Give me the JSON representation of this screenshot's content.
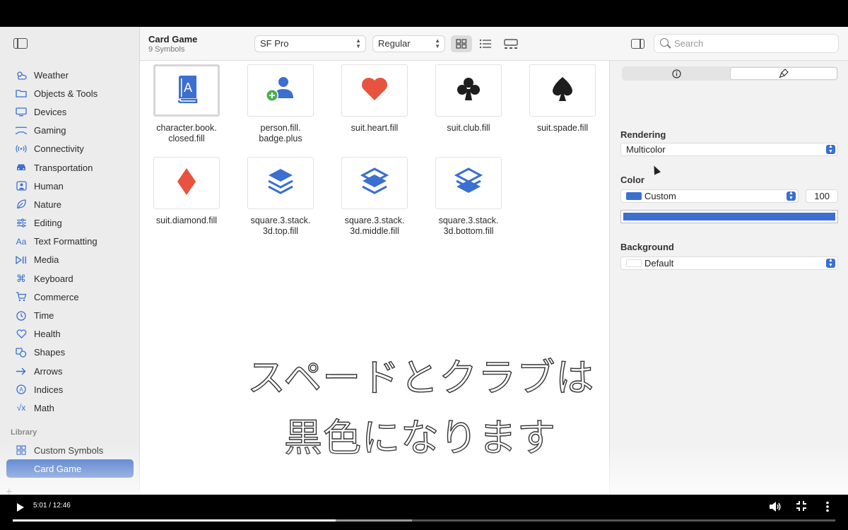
{
  "window": {
    "title": "Card Game",
    "subtitle": "9 Symbols"
  },
  "toolbar": {
    "font": "SF Pro",
    "weight": "Regular",
    "search_placeholder": "Search"
  },
  "sidebar": {
    "items": [
      {
        "label": "Weather",
        "icon": "cloud-sun-icon"
      },
      {
        "label": "Objects & Tools",
        "icon": "folder-icon"
      },
      {
        "label": "Devices",
        "icon": "monitor-icon"
      },
      {
        "label": "Gaming",
        "icon": "gamecontroller-icon"
      },
      {
        "label": "Connectivity",
        "icon": "antenna-icon"
      },
      {
        "label": "Transportation",
        "icon": "car-icon"
      },
      {
        "label": "Human",
        "icon": "person-icon"
      },
      {
        "label": "Nature",
        "icon": "leaf-icon"
      },
      {
        "label": "Editing",
        "icon": "sliders-icon"
      },
      {
        "label": "Text Formatting",
        "icon": "text-format-icon"
      },
      {
        "label": "Media",
        "icon": "play-pause-icon"
      },
      {
        "label": "Keyboard",
        "icon": "command-icon"
      },
      {
        "label": "Commerce",
        "icon": "cart-icon"
      },
      {
        "label": "Time",
        "icon": "clock-icon"
      },
      {
        "label": "Health",
        "icon": "heart-outline-icon"
      },
      {
        "label": "Shapes",
        "icon": "shapes-icon"
      },
      {
        "label": "Arrows",
        "icon": "arrows-icon"
      },
      {
        "label": "Indices",
        "icon": "circle-a-icon"
      },
      {
        "label": "Math",
        "icon": "sqrt-icon"
      }
    ],
    "library_header": "Library",
    "library": [
      {
        "label": "Custom Symbols",
        "icon": "grid-icon"
      },
      {
        "label": "Card Game",
        "icon": "folder-icon"
      }
    ]
  },
  "symbols": [
    {
      "name": "character.book.\nclosed.fill",
      "icon": "character-book-icon"
    },
    {
      "name": "person.fill.\nbadge.plus",
      "icon": "person-badge-plus-icon"
    },
    {
      "name": "suit.heart.fill",
      "icon": "heart-icon"
    },
    {
      "name": "suit.club.fill",
      "icon": "club-icon"
    },
    {
      "name": "suit.spade.fill",
      "icon": "spade-icon"
    },
    {
      "name": "suit.diamond.fill",
      "icon": "diamond-icon"
    },
    {
      "name": "square.3.stack.\n3d.top.fill",
      "icon": "stack-top-icon"
    },
    {
      "name": "square.3.stack.\n3d.middle.fill",
      "icon": "stack-middle-icon"
    },
    {
      "name": "square.3.stack.\n3d.bottom.fill",
      "icon": "stack-bottom-icon"
    }
  ],
  "inspector": {
    "rendering_label": "Rendering",
    "rendering_value": "Multicolor",
    "color_label": "Color",
    "color_value": "Custom",
    "opacity_value": "100",
    "background_label": "Background",
    "background_value": "Default"
  },
  "subtitles": [
    "スペードとクラブは",
    "黒色になります"
  ],
  "video": {
    "time": "5:01 / 12:46",
    "progress": 0.393,
    "buffered": 0.485
  },
  "colors": {
    "accent": "#3c6cc7",
    "symbol_blue": "#3b6fd0",
    "heart_red": "#e8533f",
    "club_black": "#1e1e1e",
    "badge_green": "#4caf50"
  }
}
